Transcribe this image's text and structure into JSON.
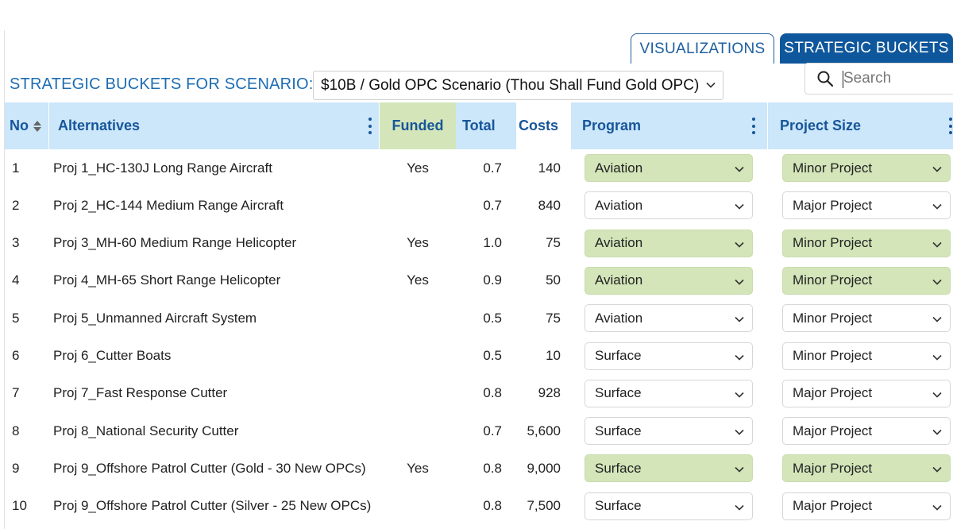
{
  "tabs": {
    "visualizations": "VISUALIZATIONS",
    "strategic_buckets": "STRATEGIC BUCKETS"
  },
  "scenario": {
    "label": "STRATEGIC BUCKETS FOR SCENARIO:",
    "selected": "$10B / Gold OPC Scenario (Thou Shall Fund Gold OPC)"
  },
  "search": {
    "placeholder": "Search",
    "value": ""
  },
  "columns": {
    "no": "No",
    "alternatives": "Alternatives",
    "funded": "Funded",
    "total": "Total",
    "costs": "Costs",
    "program": "Program",
    "project_size": "Project Size"
  },
  "colors": {
    "accent_blue": "#0f579c",
    "header_blue": "#cce6fa",
    "funded_green": "#d3e5b9",
    "header_text": "#17569a"
  },
  "rows": [
    {
      "no": "1",
      "alternative": "Proj 1_HC-130J Long Range Aircraft",
      "funded": "Yes",
      "total": "0.7",
      "costs": "140",
      "program": "Aviation",
      "project_size": "Minor Project"
    },
    {
      "no": "2",
      "alternative": "Proj 2_HC-144 Medium Range Aircraft",
      "funded": "",
      "total": "0.7",
      "costs": "840",
      "program": "Aviation",
      "project_size": "Major Project"
    },
    {
      "no": "3",
      "alternative": "Proj 3_MH-60 Medium Range Helicopter",
      "funded": "Yes",
      "total": "1.0",
      "costs": "75",
      "program": "Aviation",
      "project_size": "Minor Project"
    },
    {
      "no": "4",
      "alternative": "Proj 4_MH-65 Short Range Helicopter",
      "funded": "Yes",
      "total": "0.9",
      "costs": "50",
      "program": "Aviation",
      "project_size": "Minor Project"
    },
    {
      "no": "5",
      "alternative": "Proj 5_Unmanned Aircraft System",
      "funded": "",
      "total": "0.5",
      "costs": "75",
      "program": "Aviation",
      "project_size": "Minor Project"
    },
    {
      "no": "6",
      "alternative": "Proj 6_Cutter Boats",
      "funded": "",
      "total": "0.5",
      "costs": "10",
      "program": "Surface",
      "project_size": "Minor Project"
    },
    {
      "no": "7",
      "alternative": "Proj 7_Fast Response Cutter",
      "funded": "",
      "total": "0.8",
      "costs": "928",
      "program": "Surface",
      "project_size": "Major Project"
    },
    {
      "no": "8",
      "alternative": "Proj 8_National Security Cutter",
      "funded": "",
      "total": "0.7",
      "costs": "5,600",
      "program": "Surface",
      "project_size": "Major Project"
    },
    {
      "no": "9",
      "alternative": "Proj 9_Offshore Patrol Cutter (Gold - 30 New OPCs)",
      "funded": "Yes",
      "total": "0.8",
      "costs": "9,000",
      "program": "Surface",
      "project_size": "Major Project"
    },
    {
      "no": "10",
      "alternative": "Proj 9_Offshore Patrol Cutter (Silver - 25 New OPCs)",
      "funded": "",
      "total": "0.8",
      "costs": "7,500",
      "program": "Surface",
      "project_size": "Major Project"
    }
  ]
}
